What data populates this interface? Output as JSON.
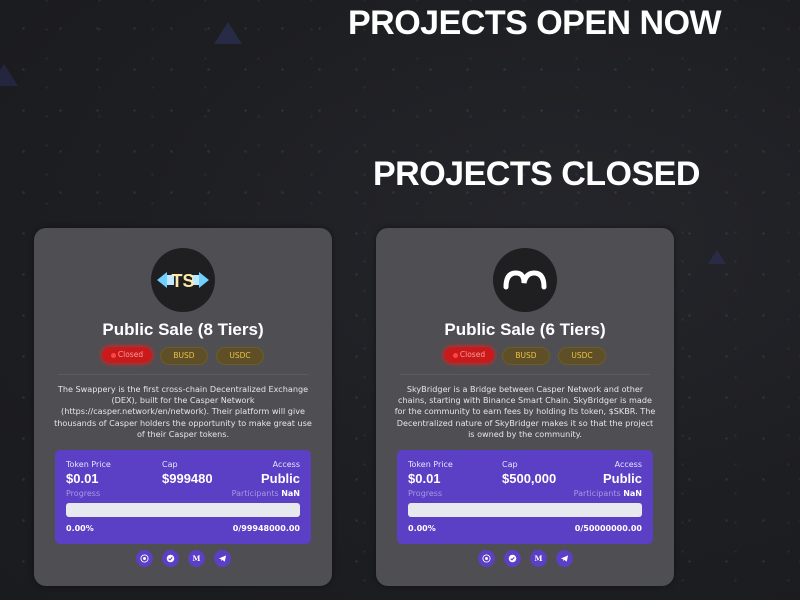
{
  "headings": {
    "open": "PROJECTS OPEN NOW",
    "closed": "PROJECTS CLOSED"
  },
  "cards": [
    {
      "logo_text": "TS",
      "logo_icon": "swappery-logo",
      "title": "Public Sale (8 Tiers)",
      "status": "Closed",
      "currencies": [
        "BUSD",
        "USDC"
      ],
      "description": "The Swappery is the first cross-chain Decentralized Exchange (DEX), built for the Casper Network (https://casper.network/en/network). Their platform will give thousands of Casper holders the opportunity to make great use of their Casper tokens.",
      "token_price_label": "Token Price",
      "token_price": "$0.01",
      "cap_label": "Cap",
      "cap": "$999480",
      "access_label": "Access",
      "access": "Public",
      "progress_label": "Progress",
      "participants_label": "Participants",
      "participants": "NaN",
      "progress_fraction": 0,
      "progress_percent": "0.00%",
      "raised": "0/99948000.00",
      "socials": [
        "website-icon",
        "telegram-icon",
        "medium-icon",
        "telegram-icon"
      ]
    },
    {
      "logo_text": "",
      "logo_icon": "skybridger-logo",
      "title": "Public Sale (6 Tiers)",
      "status": "Closed",
      "currencies": [
        "BUSD",
        "USDC"
      ],
      "description": "SkyBridger is a Bridge between Casper Network and other chains, starting with Binance Smart Chain. SkyBridger is made for the community to earn fees by holding its token, $SKBR. The Decentralized nature of SkyBridger makes it so that the project is owned by the community.",
      "token_price_label": "Token Price",
      "token_price": "$0.01",
      "cap_label": "Cap",
      "cap": "$500,000",
      "access_label": "Access",
      "access": "Public",
      "progress_label": "Progress",
      "participants_label": "Participants",
      "participants": "NaN",
      "progress_fraction": 0,
      "progress_percent": "0.00%",
      "raised": "0/50000000.00",
      "socials": [
        "website-icon",
        "telegram-icon",
        "medium-icon",
        "telegram-icon"
      ]
    }
  ],
  "colors": {
    "background": "#1e1f23",
    "card": "#4f4f53",
    "accent_purple": "#5b3fc4",
    "status_red": "#c8191b",
    "coin_gold": "#e8c24a"
  }
}
